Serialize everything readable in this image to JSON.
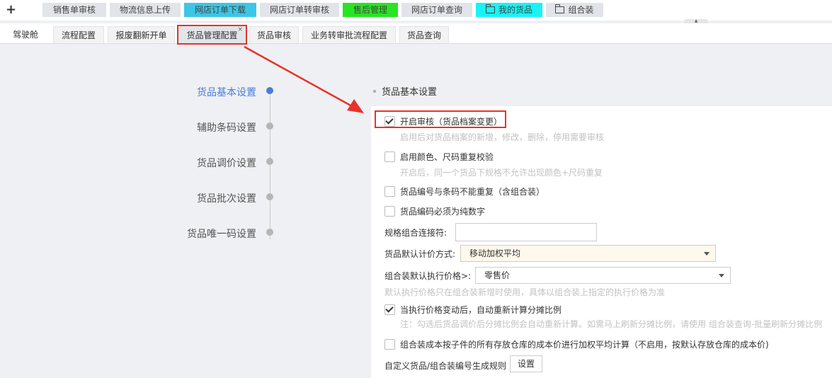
{
  "topbar": {
    "plus_label": "+",
    "quick_buttons": [
      {
        "label": "销售单审核",
        "color": "#e1e4e8"
      },
      {
        "label": "物流信息上传",
        "color": "#e1e4e8"
      },
      {
        "label": "网店订单下载",
        "color": "#3cc6e6"
      },
      {
        "label": "网店订单转审核",
        "color": "#e1e4e8"
      },
      {
        "label": "售后管理",
        "color": "#27e522"
      },
      {
        "label": "网店订单查询",
        "color": "#e1e4e8"
      },
      {
        "label": "我的货品",
        "color": "#19f3f6",
        "folder": true
      },
      {
        "label": "组合装",
        "color": "#e1e4e8",
        "folder": true
      }
    ]
  },
  "tabs": [
    {
      "label": "驾驶舱"
    },
    {
      "label": "流程配置"
    },
    {
      "label": "报废翻新开单"
    },
    {
      "label": "货品管理配置",
      "active": true,
      "close": "×"
    },
    {
      "label": "货品审核"
    },
    {
      "label": "业务转审批流程配置"
    },
    {
      "label": "货品查询"
    }
  ],
  "steps": [
    {
      "label": "货品基本设置",
      "active": true
    },
    {
      "label": "辅助条码设置"
    },
    {
      "label": "货品调价设置"
    },
    {
      "label": "货品批次设置"
    },
    {
      "label": "货品唯一码设置"
    }
  ],
  "section": {
    "title": "货品基本设置"
  },
  "settings": {
    "audit": {
      "label": "开启审核（货品档案变更）",
      "checked": true,
      "hint": "启用后对货品档案的新增，修改，删除，停用需要审核"
    },
    "color_size": {
      "label": "启用颜色、尺码重复校验",
      "checked": false,
      "hint": "开启后，同一个货品下规格不允许出现颜色+尺码重复"
    },
    "no_dup_code": {
      "label": "货品编号与条码不能重复（含组合装）",
      "checked": false
    },
    "numeric_code": {
      "label": "货品编码必须为纯数字",
      "checked": false
    },
    "spec_connector": {
      "label": "规格组合连接符:",
      "value": ""
    },
    "pricing_method": {
      "label": "货品默认计价方式:",
      "value": "移动加权平均"
    },
    "combo_price": {
      "label": "组合装默认执行价格>:",
      "value": "零售价",
      "hint": "默认执行价格只在组合装新增时使用，具体以组合装上指定的执行价格为准"
    },
    "recalc": {
      "label": "当执行价格变动后，自动重新计算分摊比例",
      "checked": true,
      "hint": "注：勾选后货品调价后分摊比例会自动重新计算。如需马上刷新分摊比例，请使用 组合装查询-批量刷新分摊比例"
    },
    "combo_cost": {
      "label": "组合装成本按子件的所有存放仓库的成本价进行加权平均计算（不启用，按默认存放仓库的成本价)",
      "checked": false
    },
    "custom_rule": {
      "label": "自定义货品/组合装编号生成规则",
      "button": "设置"
    }
  }
}
